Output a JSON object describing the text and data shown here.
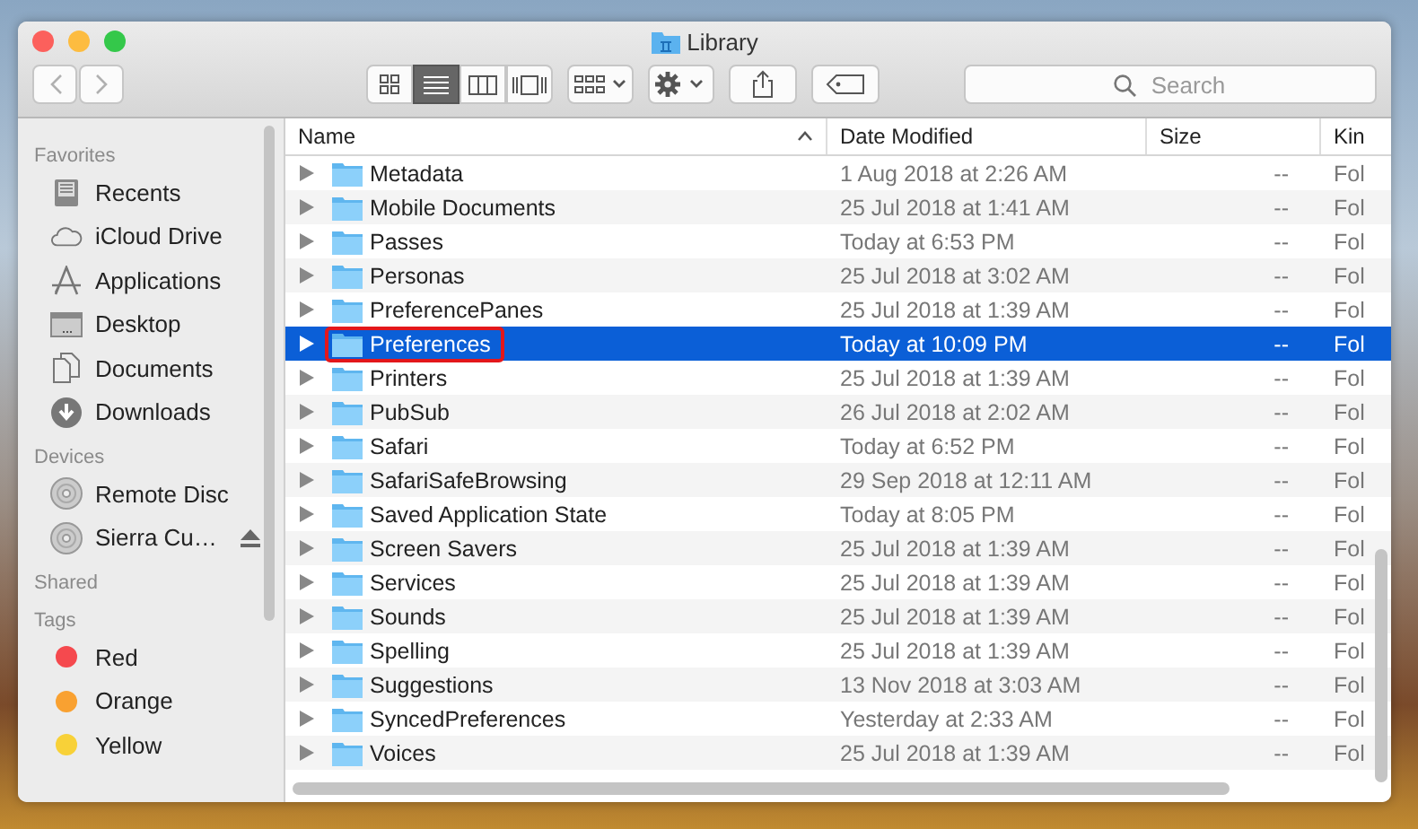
{
  "window": {
    "title": "Library"
  },
  "toolbar": {
    "view_modes": [
      {
        "kind": "icons",
        "selected": false
      },
      {
        "kind": "list",
        "selected": true
      },
      {
        "kind": "columns",
        "selected": false
      },
      {
        "kind": "gallery",
        "selected": false
      }
    ],
    "search": {
      "placeholder": "Search"
    }
  },
  "sidebar": {
    "sections": [
      {
        "heading": "Favorites",
        "items": [
          {
            "label": "Recents",
            "kind": "recents",
            "eject": false
          },
          {
            "label": "iCloud Drive",
            "kind": "cloud",
            "eject": false
          },
          {
            "label": "Applications",
            "kind": "applications",
            "eject": false
          },
          {
            "label": "Desktop",
            "kind": "desktop",
            "eject": false
          },
          {
            "label": "Documents",
            "kind": "documents",
            "eject": false
          },
          {
            "label": "Downloads",
            "kind": "downloads",
            "eject": false
          }
        ]
      },
      {
        "heading": "Devices",
        "items": [
          {
            "label": "Remote Disc",
            "kind": "disc",
            "eject": false
          },
          {
            "label": "Sierra Cu…",
            "kind": "disc",
            "eject": true
          }
        ]
      },
      {
        "heading": "Shared"
      },
      {
        "heading": "Tags",
        "items": [
          {
            "label": "Red",
            "kind": "tag",
            "color": "#f5494e",
            "eject": false
          },
          {
            "label": "Orange",
            "kind": "tag",
            "color": "#f9a131",
            "eject": false
          },
          {
            "label": "Yellow",
            "kind": "tag",
            "color": "#f8d138",
            "eject": false
          }
        ]
      }
    ]
  },
  "table": {
    "columns": [
      {
        "label": "Name",
        "sorted": true
      },
      {
        "label": "Date Modified",
        "sorted": false
      },
      {
        "label": "Size",
        "sorted": false
      },
      {
        "label": "Kin",
        "sorted": false
      }
    ],
    "rows": [
      {
        "name": "Metadata",
        "date": "1 Aug 2018 at 2:26 AM",
        "size": "--",
        "kind": "Fol",
        "selected": false,
        "outlined": false
      },
      {
        "name": "Mobile Documents",
        "date": "25 Jul 2018 at 1:41 AM",
        "size": "--",
        "kind": "Fol",
        "selected": false,
        "outlined": false
      },
      {
        "name": "Passes",
        "date": "Today at 6:53 PM",
        "size": "--",
        "kind": "Fol",
        "selected": false,
        "outlined": false
      },
      {
        "name": "Personas",
        "date": "25 Jul 2018 at 3:02 AM",
        "size": "--",
        "kind": "Fol",
        "selected": false,
        "outlined": false
      },
      {
        "name": "PreferencePanes",
        "date": "25 Jul 2018 at 1:39 AM",
        "size": "--",
        "kind": "Fol",
        "selected": false,
        "outlined": false
      },
      {
        "name": "Preferences",
        "date": "Today at 10:09 PM",
        "size": "--",
        "kind": "Fol",
        "selected": true,
        "outlined": true
      },
      {
        "name": "Printers",
        "date": "25 Jul 2018 at 1:39 AM",
        "size": "--",
        "kind": "Fol",
        "selected": false,
        "outlined": false
      },
      {
        "name": "PubSub",
        "date": "26 Jul 2018 at 2:02 AM",
        "size": "--",
        "kind": "Fol",
        "selected": false,
        "outlined": false
      },
      {
        "name": "Safari",
        "date": "Today at 6:52 PM",
        "size": "--",
        "kind": "Fol",
        "selected": false,
        "outlined": false
      },
      {
        "name": "SafariSafeBrowsing",
        "date": "29 Sep 2018 at 12:11 AM",
        "size": "--",
        "kind": "Fol",
        "selected": false,
        "outlined": false
      },
      {
        "name": "Saved Application State",
        "date": "Today at 8:05 PM",
        "size": "--",
        "kind": "Fol",
        "selected": false,
        "outlined": false
      },
      {
        "name": "Screen Savers",
        "date": "25 Jul 2018 at 1:39 AM",
        "size": "--",
        "kind": "Fol",
        "selected": false,
        "outlined": false
      },
      {
        "name": "Services",
        "date": "25 Jul 2018 at 1:39 AM",
        "size": "--",
        "kind": "Fol",
        "selected": false,
        "outlined": false
      },
      {
        "name": "Sounds",
        "date": "25 Jul 2018 at 1:39 AM",
        "size": "--",
        "kind": "Fol",
        "selected": false,
        "outlined": false
      },
      {
        "name": "Spelling",
        "date": "25 Jul 2018 at 1:39 AM",
        "size": "--",
        "kind": "Fol",
        "selected": false,
        "outlined": false
      },
      {
        "name": "Suggestions",
        "date": "13 Nov 2018 at 3:03 AM",
        "size": "--",
        "kind": "Fol",
        "selected": false,
        "outlined": false
      },
      {
        "name": "SyncedPreferences",
        "date": "Yesterday at 2:33 AM",
        "size": "--",
        "kind": "Fol",
        "selected": false,
        "outlined": false
      },
      {
        "name": "Voices",
        "date": "25 Jul 2018 at 1:39 AM",
        "size": "--",
        "kind": "Fol",
        "selected": false,
        "outlined": false
      }
    ]
  }
}
